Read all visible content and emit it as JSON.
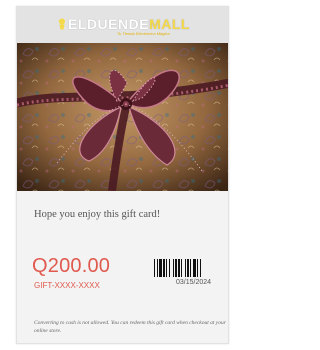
{
  "brand": {
    "name_part1": "ELDUENDE",
    "name_part2": "MALL",
    "tagline": "Tu Tienda Electrónica Mágica"
  },
  "card": {
    "message": "Hope you enjoy this gift card!",
    "amount": "Q200.00",
    "code": "GIFT-XXXX-XXXX",
    "date": "03/15/2024",
    "disclaimer": "Converting to cash is not allowed. You can redeem this gift card when checkout at your online store."
  },
  "colors": {
    "accent": "#e05a4f",
    "logo_yellow": "#f4d94a",
    "header_bg": "#e3e3e3",
    "card_bg": "#f3f3f3"
  },
  "icons": {
    "logo": "elf-logo-icon",
    "hero": "wrapped-gift-photo"
  }
}
